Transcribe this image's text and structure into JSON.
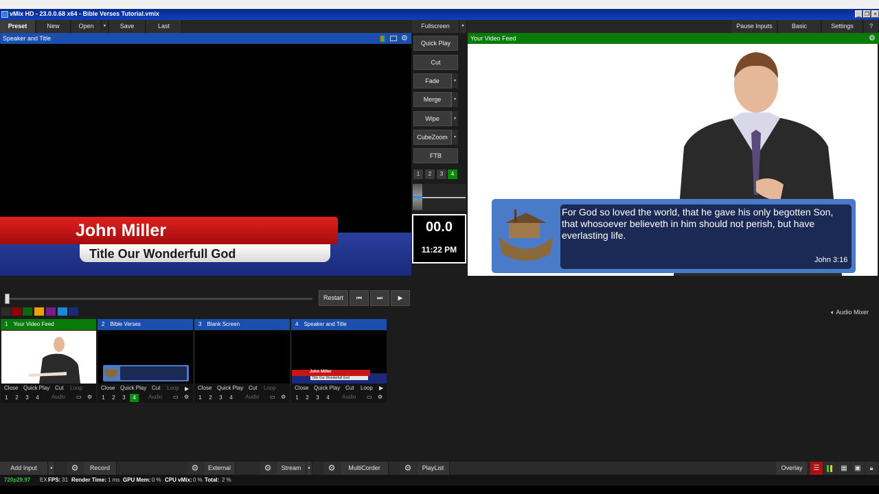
{
  "window": {
    "title": "vMix HD - 23.0.0.68 x64 - Bible Verses Tutorial.vmix"
  },
  "menu": {
    "left": [
      "Preset",
      "New",
      "Open",
      "Save",
      "Last"
    ],
    "fullscreen": "Fullscreen",
    "right": [
      "Pause Inputs",
      "Basic",
      "Settings",
      "?"
    ]
  },
  "preview": {
    "header": "Speaker and Title",
    "lower_third": {
      "name": "John Miller",
      "title": "Title Our Wonderfull God"
    }
  },
  "output": {
    "header": "Your Video Feed",
    "verse": "For God so loved the world, that he gave his only begotten Son, that whosoever believeth in him should not perish, but have everlasting life.",
    "reference": "John 3:16"
  },
  "transitions": {
    "buttons": [
      "Quick Play",
      "Cut",
      "Fade",
      "Merge",
      "Wipe",
      "CubeZoom",
      "FTB"
    ],
    "numbers": [
      "1",
      "2",
      "3",
      "4"
    ],
    "active_number": "4",
    "clock_counter": "00.0",
    "clock_time": "11:22 PM"
  },
  "transport": {
    "restart": "Restart",
    "prev_icon": "skip-back-icon",
    "next_icon": "skip-forward-icon",
    "play_icon": "play-icon"
  },
  "color_tags": [
    "#2a2a2a",
    "#8b0000",
    "#0a6a0a",
    "#f0a000",
    "#7a1a8a",
    "#1a8ad8",
    "#1a2a7a"
  ],
  "audio_mixer": "Audio Mixer",
  "inputs": [
    {
      "num": "1",
      "label": "Your Video Feed",
      "color": "#087b08",
      "actions": [
        "Close",
        "Quick Play",
        "Cut",
        "Loop"
      ],
      "loop_dim": true,
      "nums": [
        "1",
        "2",
        "3",
        "4"
      ],
      "active": "",
      "audio": "Audio"
    },
    {
      "num": "2",
      "label": "Bible Verses",
      "color": "#1b4fae",
      "actions": [
        "Close",
        "Quick Play",
        "Cut",
        "Loop"
      ],
      "loop_dim": true,
      "nums": [
        "1",
        "2",
        "3",
        "4"
      ],
      "active": "4",
      "audio": "Audio"
    },
    {
      "num": "3",
      "label": "Blank Screen",
      "color": "#1b4fae",
      "actions": [
        "Close",
        "Quick Play",
        "Cut",
        "Loop"
      ],
      "loop_dim": true,
      "nums": [
        "1",
        "2",
        "3",
        "4"
      ],
      "active": "",
      "audio": "Audio"
    },
    {
      "num": "4",
      "label": "Speaker and Title",
      "color": "#1b4fae",
      "actions": [
        "Close",
        "Quick Play",
        "Cut",
        "Loop"
      ],
      "loop_dim": false,
      "nums": [
        "1",
        "2",
        "3",
        "4"
      ],
      "active": "",
      "audio": "Audio"
    }
  ],
  "thumb_text": {
    "name": "John Miller",
    "title": "Title Our Wonderfull God"
  },
  "bottom": {
    "add_input": "Add Input",
    "record": "Record",
    "external": "External",
    "stream": "Stream",
    "multicorder": "MultiCorder",
    "playlist": "PlayList",
    "overlay": "Overlay"
  },
  "status": {
    "format": "720p29.97",
    "ex": "EX",
    "fps_label": "FPS:",
    "fps": "31",
    "render_label": "Render Time:",
    "render": "1 ms",
    "gpu_label": "GPU Mem:",
    "gpu": "0 %",
    "cpu_label": "CPU vMix:",
    "cpu": "0 %",
    "total_label": "Total:",
    "total": "2 %"
  }
}
